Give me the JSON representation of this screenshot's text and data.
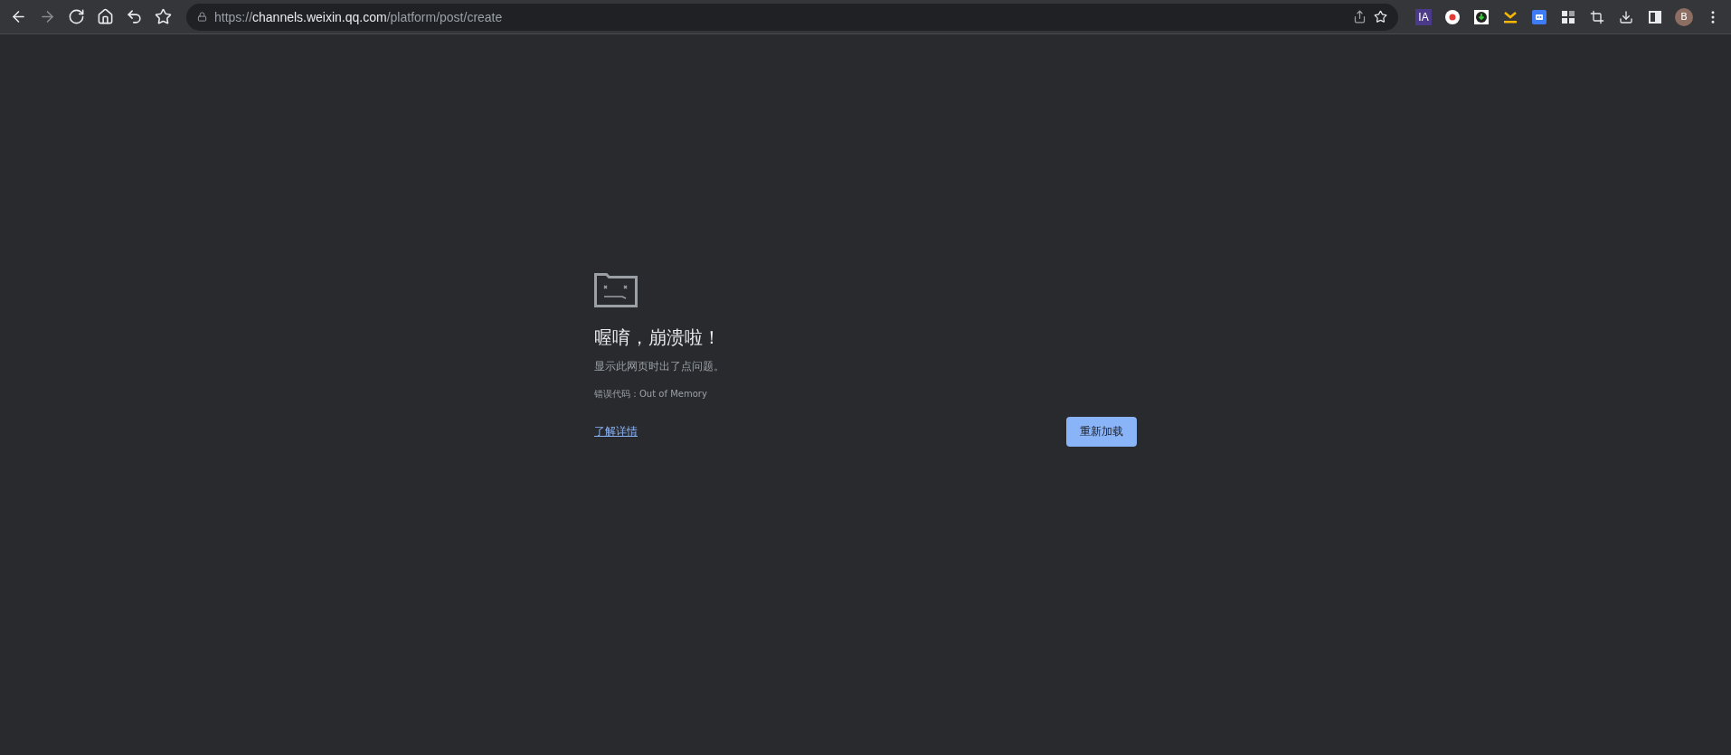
{
  "toolbar": {
    "nav_buttons": [
      {
        "kind": "back",
        "disabled": false
      },
      {
        "kind": "forward",
        "disabled": true
      },
      {
        "kind": "reload",
        "disabled": false
      },
      {
        "kind": "home",
        "disabled": false
      },
      {
        "kind": "undo",
        "disabled": false
      },
      {
        "kind": "bookmark",
        "disabled": false
      }
    ],
    "address": {
      "scheme": "https://",
      "host": "channels.weixin.qq.com",
      "path": "/platform/post/create"
    },
    "extensions": [
      {
        "kind": "ia",
        "label": "IA"
      },
      {
        "kind": "record"
      },
      {
        "kind": "download-circle"
      },
      {
        "kind": "yellow-down"
      },
      {
        "kind": "robot"
      },
      {
        "kind": "grid"
      },
      {
        "kind": "crop"
      },
      {
        "kind": "download"
      },
      {
        "kind": "sidepanel"
      },
      {
        "kind": "avatar",
        "label": "B"
      },
      {
        "kind": "menu"
      }
    ]
  },
  "error": {
    "title": "喔唷，崩溃啦！",
    "message": "显示此网页时出了点问题。",
    "code": "错误代码：Out of Memory",
    "link": "了解详情",
    "button": "重新加载"
  }
}
